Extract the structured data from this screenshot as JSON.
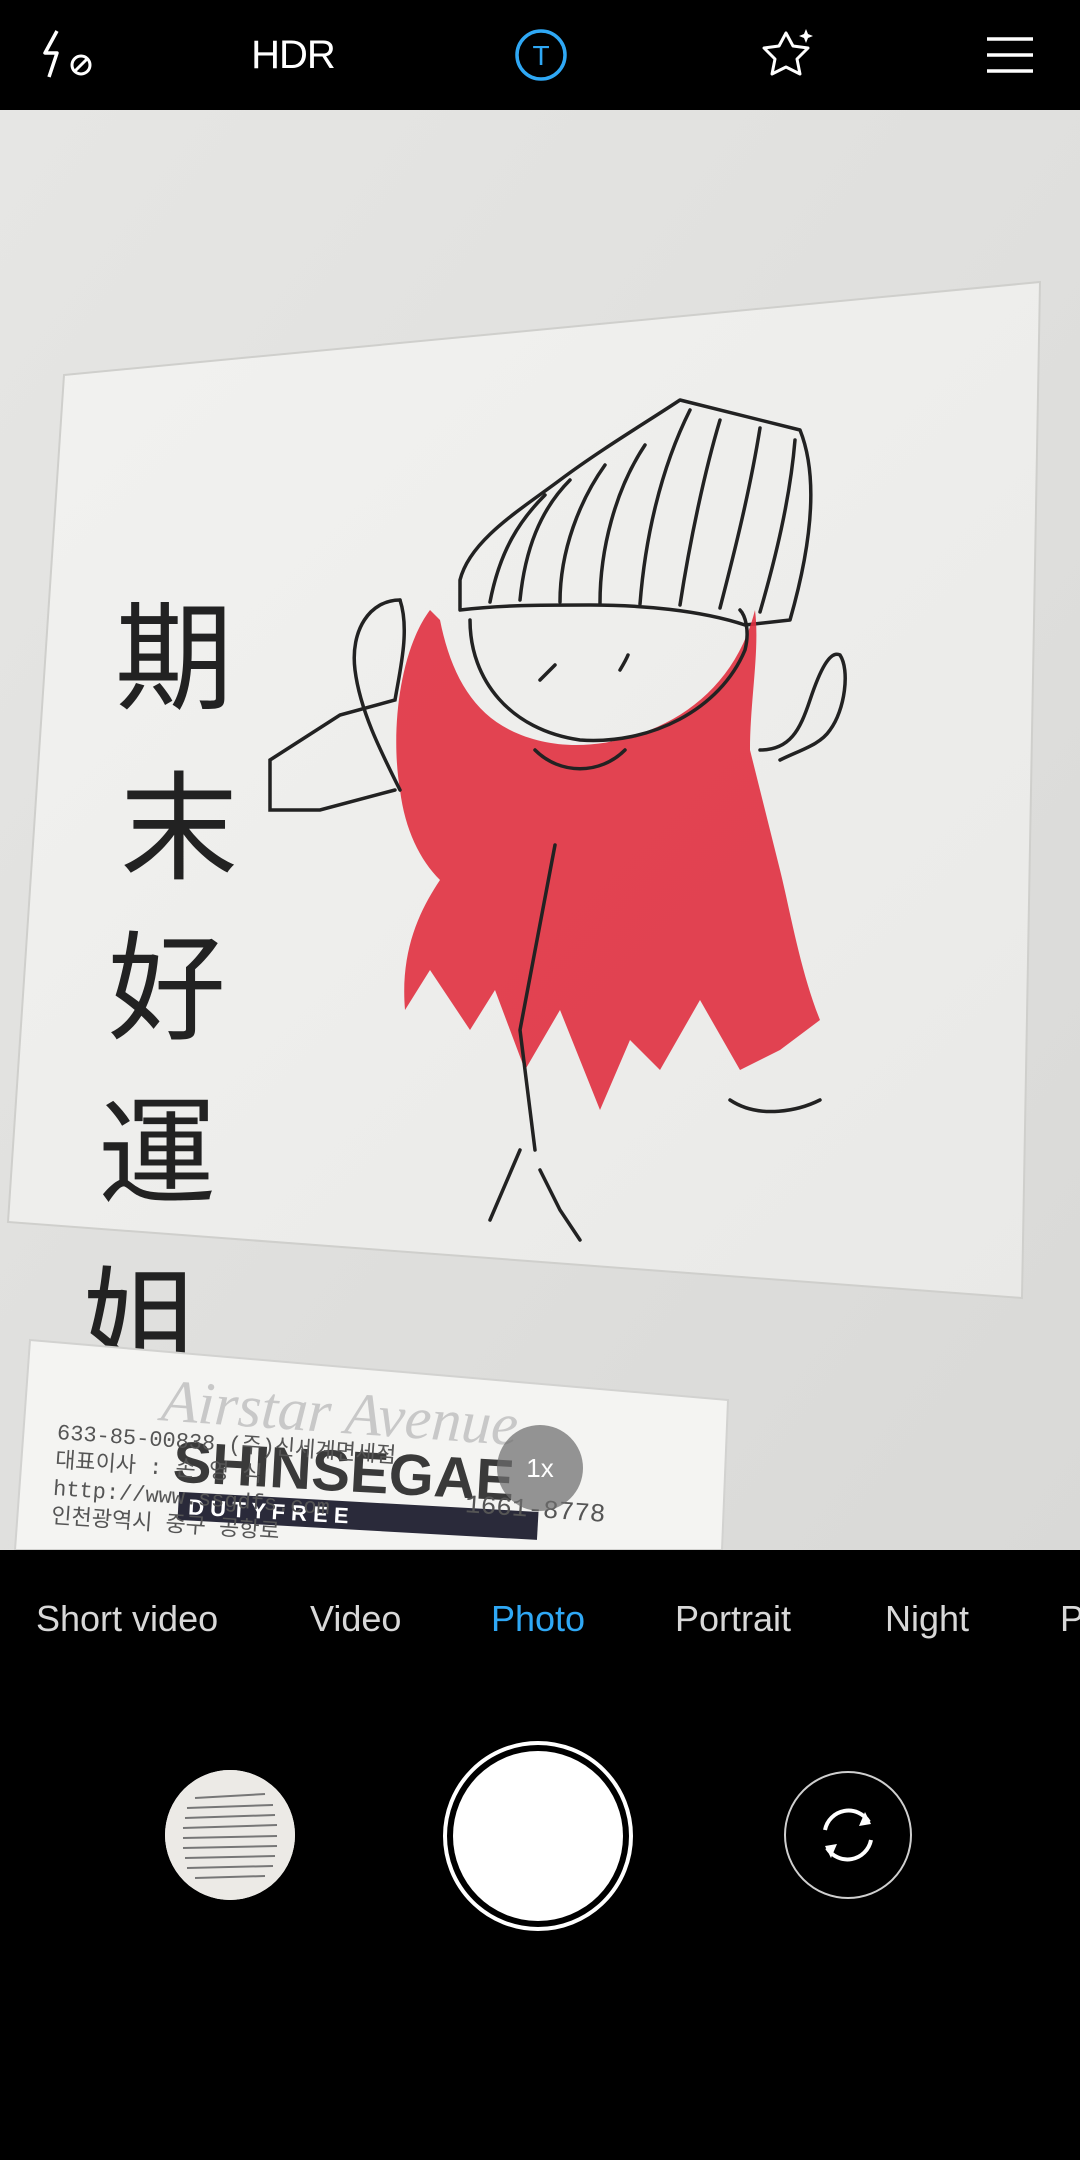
{
  "top_bar": {
    "flash_icon": "flash-off-icon",
    "hdr_label": "HDR",
    "timer_label": "T",
    "beauty_icon": "sparkle-star-icon",
    "menu_icon": "hamburger-menu-icon",
    "accent_color": "#2fa8f5"
  },
  "viewfinder": {
    "drawing_chars": [
      "期",
      "末",
      "好",
      "運",
      "姐"
    ],
    "card": {
      "watermark": "Airstar Avenue",
      "brand": "SHINSEGAE",
      "sub_brand": "D U T Y F R E E",
      "line1": "633-85-00838 (주)신세계면세점",
      "line2": "대표이사 : 손 영 식",
      "line3": "http://www.ssgdfs.com",
      "line4": "인천광역시 중구 공항로",
      "phone": "1661-8778"
    },
    "zoom_label": "1x"
  },
  "modes": {
    "items": [
      "Short video",
      "Video",
      "Photo",
      "Portrait",
      "Night",
      "P"
    ],
    "active": "Photo"
  },
  "controls": {
    "gallery_icon": "gallery-thumbnail",
    "shutter_icon": "shutter-button",
    "switch_icon": "switch-camera-icon"
  }
}
